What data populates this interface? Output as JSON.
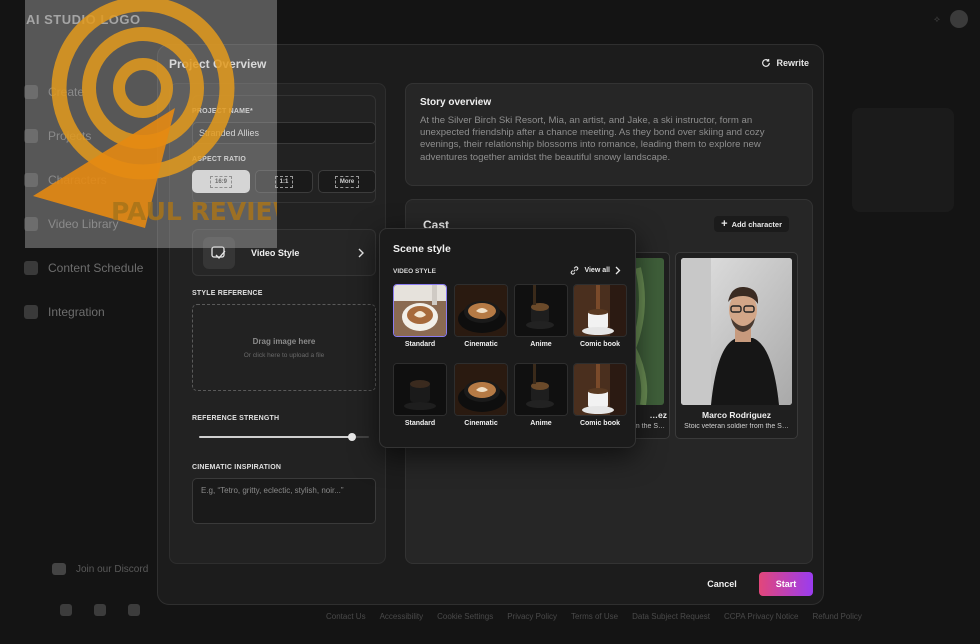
{
  "background": {
    "logo": "AI STUDIO LOGO",
    "nav": [
      {
        "label": "Create"
      },
      {
        "label": "Projects"
      },
      {
        "label": "Characters"
      },
      {
        "label": "Video Library"
      },
      {
        "label": "Content Schedule"
      },
      {
        "label": "Integration"
      }
    ],
    "discord": "Join our Discord",
    "footer_links": [
      "Contact Us",
      "Accessibility",
      "Cookie Settings",
      "Privacy Policy",
      "Terms of Use",
      "Data Subject Request",
      "CCPA Privacy Notice",
      "Refund Policy"
    ]
  },
  "watermark": {
    "text": "PAUL REVIEW"
  },
  "modal": {
    "title": "Project Overview",
    "rewrite_label": "Rewrite",
    "project_name_label": "PROJECT NAME*",
    "project_name_value": "Stranded Allies",
    "aspect_ratio_label": "ASPECT RATIO",
    "aspect_ratios": [
      "16:9",
      "1:1",
      "More"
    ],
    "aspect_ratio_selected": "16:9",
    "video_style_label": "Video Style",
    "style_reference_label": "STYLE REFERENCE",
    "dropzone_title": "Drag image here",
    "dropzone_sub": "Or click here to upload a file",
    "reference_strength_label": "REFERENCE STRENGTH",
    "reference_strength_value": 0.9,
    "cinematic_label": "CINEMATIC INSPIRATION",
    "cinematic_placeholder": "E.g, “Tetro, gritty, eclectic, stylish, noir...”",
    "story_title": "Story overview",
    "story_text": "At the Silver Birch Ski Resort, Mia, an artist, and Jake, a ski instructor, form an unexpected friendship after a chance meeting. As they bond over skiing and cozy evenings, their relationship blossoms into romance, leading them to explore new adventures together amidst the beautiful snowy landscape.",
    "cast_title": "Cast",
    "add_character_label": "Add character",
    "characters": [
      {
        "name": "…ez",
        "desc": "…m the S…"
      },
      {
        "name": "Marco Rodriguez",
        "desc": "Stoic veteran soldier from the S…"
      }
    ],
    "cancel_label": "Cancel",
    "start_label": "Start"
  },
  "scene_style": {
    "title": "Scene style",
    "subtitle": "VIDEO STYLE",
    "view_all_label": "View all",
    "styles": [
      {
        "label": "Standard",
        "selected": true
      },
      {
        "label": "Cinematic",
        "selected": false
      },
      {
        "label": "Anime",
        "selected": false
      },
      {
        "label": "Comic book",
        "selected": false
      },
      {
        "label": "Standard",
        "selected": false
      },
      {
        "label": "Cinematic",
        "selected": false
      },
      {
        "label": "Anime",
        "selected": false
      },
      {
        "label": "Comic book",
        "selected": false
      }
    ]
  },
  "colors": {
    "accent_start": "#e2467a",
    "accent_end": "#9a3cf0",
    "selected_border": "#8a7cf0"
  }
}
